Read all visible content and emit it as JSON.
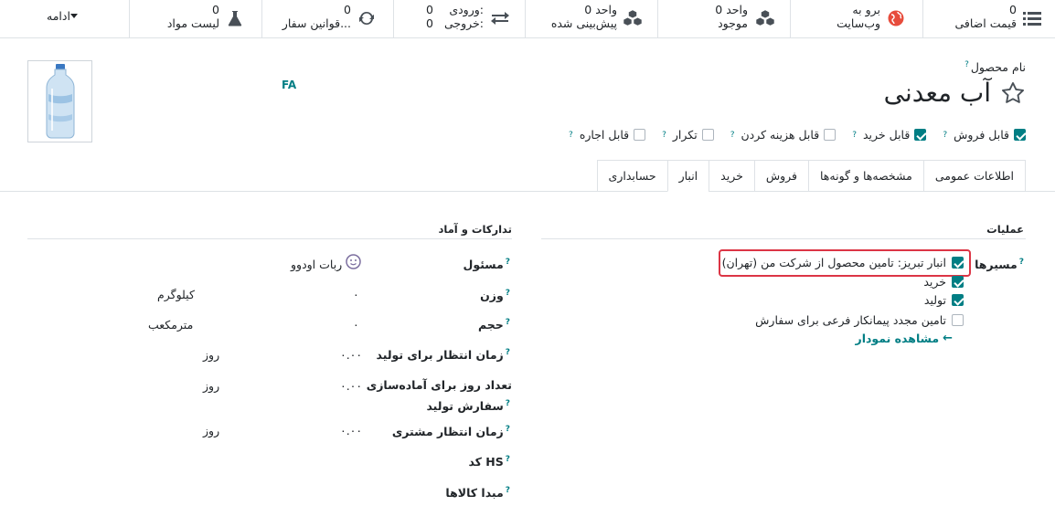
{
  "buttonbox": {
    "more_label": "ادامه",
    "buttons": [
      {
        "value": "0",
        "label": "قیمت اضافی",
        "icon": "list-icon"
      },
      {
        "value": "برو به",
        "label": "وب‌سایت",
        "icon": "globe-icon"
      },
      {
        "value": "0 واحد",
        "label": "موجود",
        "icon": "cubes-icon"
      },
      {
        "value": "0 واحد",
        "label": "پیش‌بینی شده",
        "icon": "cubes-icon"
      },
      {
        "value": "ورودی:",
        "value_num": "0",
        "label": "خروجی:",
        "label_num": "0",
        "icon": "exchange-icon"
      },
      {
        "value": "0",
        "label": "قوانین سفار...",
        "icon": "refresh-icon"
      },
      {
        "value": "0",
        "label": "لیست مواد",
        "icon": "flask-icon"
      }
    ]
  },
  "product": {
    "name_label": "نام محصول",
    "name": "آب معدنی",
    "lang": "FA"
  },
  "options": [
    {
      "label": "قابل فروش",
      "checked": true
    },
    {
      "label": "قابل خرید",
      "checked": true
    },
    {
      "label": "قابل هزینه کردن",
      "checked": false
    },
    {
      "label": "تکرار",
      "checked": false
    },
    {
      "label": "قابل اجاره",
      "checked": false
    }
  ],
  "tabs": [
    "اطلاعات عمومی",
    "مشخصه‌ها و گونه‌ها",
    "فروش",
    "خرید",
    "انبار",
    "حسابداری"
  ],
  "active_tab": "انبار",
  "operations": {
    "title": "عملیات",
    "routes_label": "مسیرها",
    "routes": [
      {
        "label": "انبار تبریز: تامین محصول از شرکت من (تهران)",
        "checked": true
      },
      {
        "label": "خرید",
        "checked": true
      },
      {
        "label": "تولید",
        "checked": true
      },
      {
        "label": "تامین مجدد پیمانکار فرعی برای سفارش",
        "checked": false
      }
    ],
    "diagram_link": "مشاهده نمودار"
  },
  "logistics": {
    "title": "تدارکات و آماد",
    "responsible_label": "مسئول",
    "responsible_value": "ربات اودوو",
    "weight_label": "وزن",
    "weight_value": "۰",
    "weight_unit": "کیلوگرم",
    "volume_label": "حجم",
    "volume_value": "۰",
    "volume_unit": "مترمکعب",
    "mfg_lead_label": "زمان انتظار برای تولید",
    "mfg_lead_value": "۰.۰۰",
    "mfg_lead_unit": "روز",
    "prep_label_1": "تعداد روز برای آماده‌سازی",
    "prep_label_2": "سفارش تولید",
    "prep_value": "۰.۰۰",
    "prep_unit": "روز",
    "cust_lead_label": "زمان انتظار مشتری",
    "cust_lead_value": "۰.۰۰",
    "cust_lead_unit": "روز",
    "hs_label": "کد HS",
    "origin_label": "مبدا کالاها"
  },
  "colors": {
    "accent": "#017e84",
    "highlight": "#dc3545",
    "globe": "#e74c3c"
  }
}
